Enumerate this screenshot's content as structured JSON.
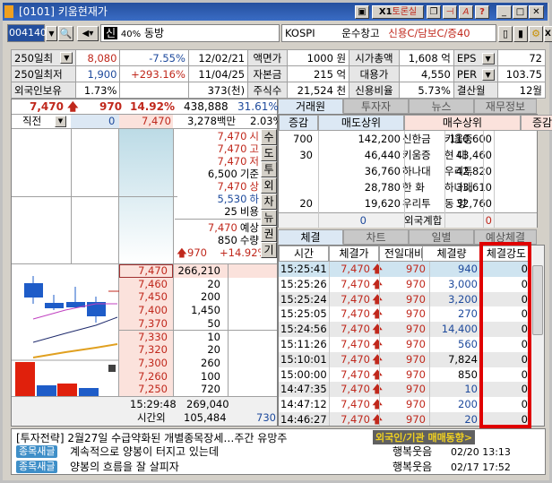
{
  "window": {
    "title": "[0101] 키움현재가",
    "toolbar_buttons": [
      "토론실",
      "?"
    ]
  },
  "toolbar": {
    "code": "004140",
    "credit_badge": "신",
    "margin": "40%",
    "stock_name": "동방",
    "market": "KOSPI",
    "sector": "운수창고",
    "credit_info": "신용C/담보C/증40",
    "x1": "X1"
  },
  "info": {
    "rows": [
      [
        "250일최",
        "8,080",
        "-7.55%",
        "12/02/21",
        "액면가",
        "1000 원",
        "시가총액",
        "1,608 억",
        "EPS",
        "72"
      ],
      [
        "250일최저",
        "1,900",
        "+293.16%",
        "11/04/25",
        "자본금",
        "215 억",
        "대용가",
        "4,550",
        "PER",
        "103.75"
      ],
      [
        "외국인보유",
        "1.73%",
        "",
        "373(천)",
        "주식수",
        "21,524 천",
        "신용비율",
        "5.73%",
        "결산월",
        "12월"
      ]
    ]
  },
  "price": {
    "current": "7,470",
    "change": "970",
    "rate": "14.92%",
    "volume": "438,888",
    "ratio": "31.61%"
  },
  "prev": {
    "label": "직전",
    "left": "0",
    "price": "7,470",
    "amount": "3,278백만",
    "pct": "2.03%"
  },
  "summary": {
    "items": [
      [
        "7,470",
        "시"
      ],
      [
        "7,470",
        "고"
      ],
      [
        "7,470",
        "저"
      ],
      [
        "6,500",
        "기준"
      ],
      [
        "7,470",
        "상"
      ],
      [
        "5,530",
        "하"
      ],
      [
        "25",
        "비용"
      ]
    ],
    "expected": [
      [
        "7,470",
        "예상"
      ],
      [
        "850",
        "수량"
      ]
    ],
    "exp_change": "970",
    "exp_rate": "+14.92%"
  },
  "side_buttons": [
    "수",
    "도",
    "투",
    "외",
    "차",
    "뉴",
    "권",
    "기"
  ],
  "bids": [
    [
      "7,470",
      "266,210"
    ],
    [
      "7,460",
      "20"
    ],
    [
      "7,450",
      "200"
    ],
    [
      "7,400",
      "1,450"
    ],
    [
      "7,370",
      "50"
    ],
    [
      "7,330",
      "10"
    ],
    [
      "7,320",
      "20"
    ],
    [
      "7,300",
      "260"
    ],
    [
      "7,260",
      "100"
    ],
    [
      "7,250",
      "720"
    ]
  ],
  "orderbook_footer": {
    "time": "15:29:48",
    "total": "269,040",
    "after_label": "시간외",
    "after_volume": "105,484",
    "after_right": "730"
  },
  "broker_tabs": [
    "거래원",
    "투자자",
    "뉴스",
    "재무정보"
  ],
  "broker": {
    "headers": [
      "증감",
      "매도상위",
      "매수상위",
      "증감"
    ],
    "rows": [
      [
        "700",
        "142,200",
        "신한금",
        "키움증",
        "110,600",
        ""
      ],
      [
        "30",
        "46,440",
        "키움증",
        "현  대",
        "43,460",
        ""
      ],
      [
        "",
        "36,760",
        "하나대",
        "우리투",
        "42,820",
        ""
      ],
      [
        "",
        "28,780",
        "한  화",
        "하나대",
        "33,610",
        ""
      ],
      [
        "20",
        "19,620",
        "우리투",
        "동  양",
        "32,760",
        ""
      ]
    ],
    "foreign": {
      "sell": "0",
      "label": "외국계합",
      "buy": "0"
    }
  },
  "trade_tabs": [
    "체결",
    "차트",
    "일별",
    "예상체결"
  ],
  "trades": {
    "headers": [
      "시간",
      "체결가",
      "전일대비",
      "체결량",
      "체결강도"
    ],
    "rows": [
      [
        "15:25:41",
        "7,470",
        "970",
        "940",
        "0"
      ],
      [
        "15:25:26",
        "7,470",
        "970",
        "3,000",
        "0"
      ],
      [
        "15:25:24",
        "7,470",
        "970",
        "3,200",
        "0"
      ],
      [
        "15:25:05",
        "7,470",
        "970",
        "270",
        "0"
      ],
      [
        "15:24:56",
        "7,470",
        "970",
        "14,400",
        "0"
      ],
      [
        "15:11:26",
        "7,470",
        "970",
        "560",
        "0"
      ],
      [
        "15:10:01",
        "7,470",
        "970",
        "7,824",
        "0"
      ],
      [
        "15:00:00",
        "7,470",
        "970",
        "850",
        "0"
      ],
      [
        "14:47:35",
        "7,470",
        "970",
        "10",
        "0"
      ],
      [
        "14:47:12",
        "7,470",
        "970",
        "200",
        "0"
      ],
      [
        "14:46:27",
        "7,470",
        "970",
        "20",
        "0"
      ]
    ]
  },
  "news": {
    "headline": "[투자전략] 2월27일 수급약화된 개별종목장세…주간 유망주",
    "promo": "외국인/기관 매매동향>",
    "items": [
      {
        "badge": "종목새글",
        "title": "계속적으로 양봉이 터지고 있는데",
        "author": "행복웃음",
        "time": "02/20 13:13"
      },
      {
        "badge": "종목새글",
        "title": "양봉의 흐름을 잘 살피자",
        "author": "행복웃음",
        "time": "02/17 17:52"
      }
    ]
  },
  "colors": {
    "up": "#c0281c",
    "down": "#1e4a9c",
    "title": "#244f9e",
    "highlight": "#e00000"
  }
}
